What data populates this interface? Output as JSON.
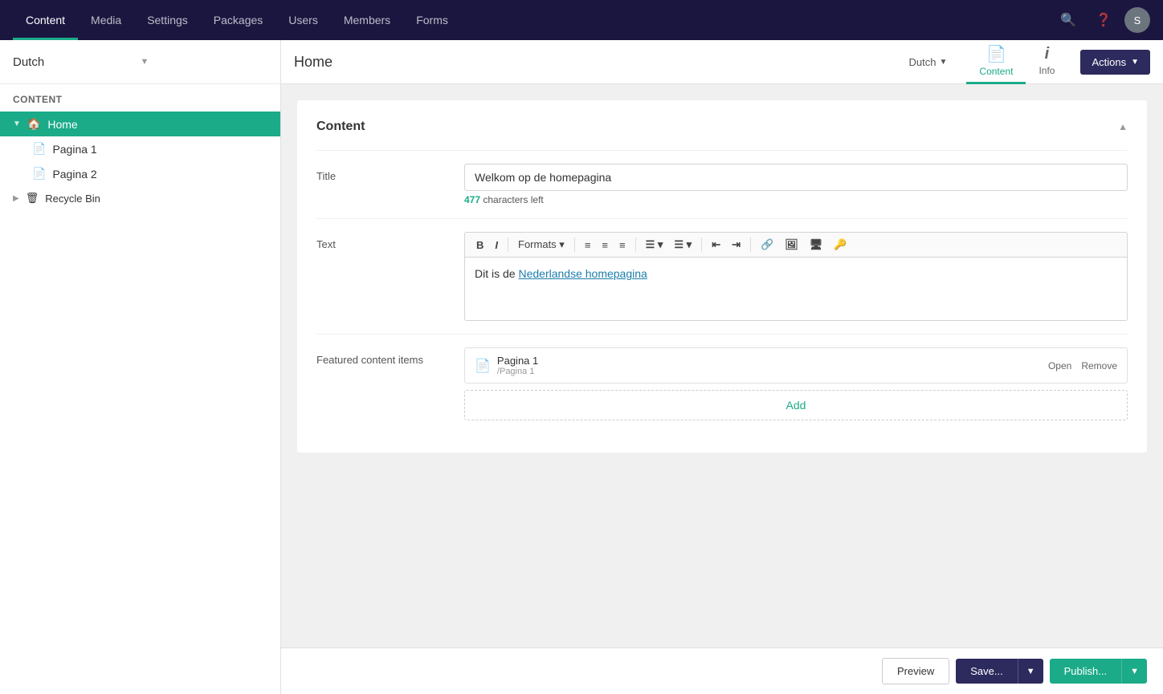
{
  "topnav": {
    "items": [
      {
        "label": "Content",
        "active": true
      },
      {
        "label": "Media",
        "active": false
      },
      {
        "label": "Settings",
        "active": false
      },
      {
        "label": "Packages",
        "active": false
      },
      {
        "label": "Users",
        "active": false
      },
      {
        "label": "Members",
        "active": false
      },
      {
        "label": "Forms",
        "active": false
      }
    ],
    "avatar_label": "S"
  },
  "sidebar": {
    "language": "Dutch",
    "section_label": "Content",
    "tree": {
      "home_label": "Home",
      "pagina1_label": "Pagina 1",
      "pagina2_label": "Pagina 2",
      "recycle_label": "Recycle Bin"
    }
  },
  "content_header": {
    "page_title": "Home",
    "language": "Dutch",
    "tabs": [
      {
        "label": "Content",
        "icon": "📄",
        "active": true
      },
      {
        "label": "Info",
        "icon": "ℹ",
        "active": false
      }
    ],
    "actions_label": "Actions"
  },
  "content_panel": {
    "title": "Content",
    "fields": {
      "title_label": "Title",
      "title_value": "Welkom op de homepagina",
      "title_chars_left": "477",
      "title_chars_text": "characters left",
      "text_label": "Text",
      "text_content": "Dit is de ",
      "text_link": "Nederlandse homepagina",
      "featured_label": "Featured content items",
      "featured_items": [
        {
          "name": "Pagina 1",
          "path": "/Pagina 1"
        }
      ],
      "add_label": "Add",
      "open_label": "Open",
      "remove_label": "Remove"
    }
  },
  "footer": {
    "preview_label": "Preview",
    "save_label": "Save...",
    "publish_label": "Publish..."
  },
  "rte_toolbar": {
    "bold": "B",
    "italic": "I",
    "formats": "Formats",
    "align_left": "≡",
    "align_center": "≡",
    "align_right": "≡",
    "ul": "☰",
    "ol": "☰",
    "indent_out": "←",
    "indent_in": "→",
    "link": "🔗",
    "image": "🖼",
    "media": "🖥",
    "key": "🔑"
  }
}
